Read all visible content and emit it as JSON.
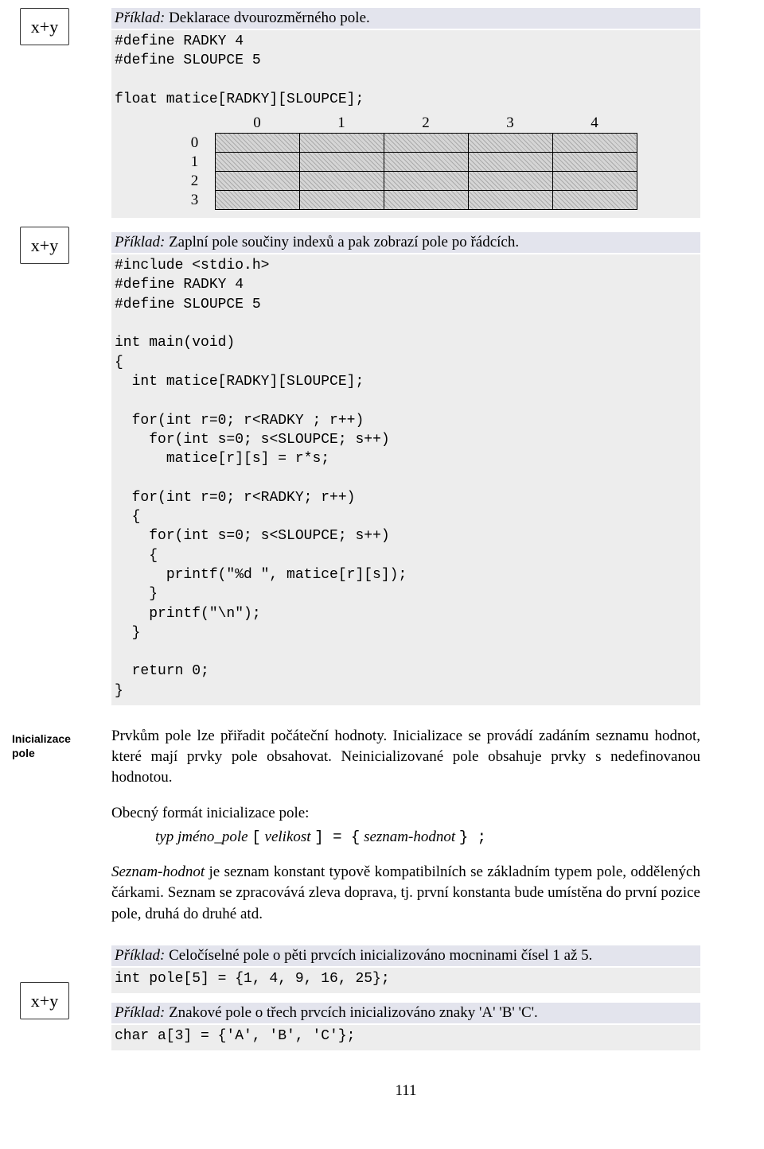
{
  "icon_text": "x+y",
  "example1": {
    "label": "Příklad:",
    "rest": " Deklarace dvourozměrného pole.",
    "code": "#define RADKY 4\n#define SLOUPCE 5\n\nfloat matice[RADKY][SLOUPCE];"
  },
  "matrix": {
    "cols": [
      "0",
      "1",
      "2",
      "3",
      "4"
    ],
    "rows": [
      "0",
      "1",
      "2",
      "3"
    ]
  },
  "example2": {
    "label": "Příklad:",
    "rest": " Zaplní pole součiny indexů a pak zobrazí pole po řádcích.",
    "code": "#include <stdio.h>\n#define RADKY 4\n#define SLOUPCE 5\n\nint main(void)\n{\n  int matice[RADKY][SLOUPCE];\n\n  for(int r=0; r<RADKY ; r++)\n    for(int s=0; s<SLOUPCE; s++)\n      matice[r][s] = r*s;\n\n  for(int r=0; r<RADKY; r++)\n  {\n    for(int s=0; s<SLOUPCE; s++)\n    {\n      printf(\"%d \", matice[r][s]);\n    }\n    printf(\"\\n\");\n  }\n\n  return 0;\n}"
  },
  "side_label": "Inicializace pole",
  "body": {
    "p1": "Prvkům pole lze přiřadit počáteční hodnoty. Inicializace se provádí zadáním seznamu hodnot, které mají prvky pole obsahovat. Neinicializované pole obsahuje prvky s nedefinovanou hodnotou.",
    "p2": "Obecný formát inicializace pole:",
    "fmt_pre": "typ jméno_pole ",
    "fmt_b1": "[",
    "fmt_mid1": " velikost ",
    "fmt_b2": "] = {",
    "fmt_mid2": " seznam-hodnot ",
    "fmt_b3": "} ;",
    "p3_a": "Seznam-hodnot",
    "p3_b": " je seznam konstant typově kompatibilních se základním typem pole, oddělených čárkami. Seznam se zpracovává zleva doprava, tj. první konstanta bude umístěna do první pozice pole, druhá do druhé atd."
  },
  "example3": {
    "label": "Příklad:",
    "rest": " Celočíselné pole o pěti prvcích inicializováno mocninami čísel 1 až 5.",
    "code": "int pole[5] = {1, 4, 9, 16, 25};"
  },
  "example4": {
    "label": "Příklad:",
    "rest": " Znakové pole o třech prvcích inicializováno znaky 'A'  'B'  'C'.",
    "code": "char a[3] = {'A', 'B', 'C'};"
  },
  "page_number": "111"
}
